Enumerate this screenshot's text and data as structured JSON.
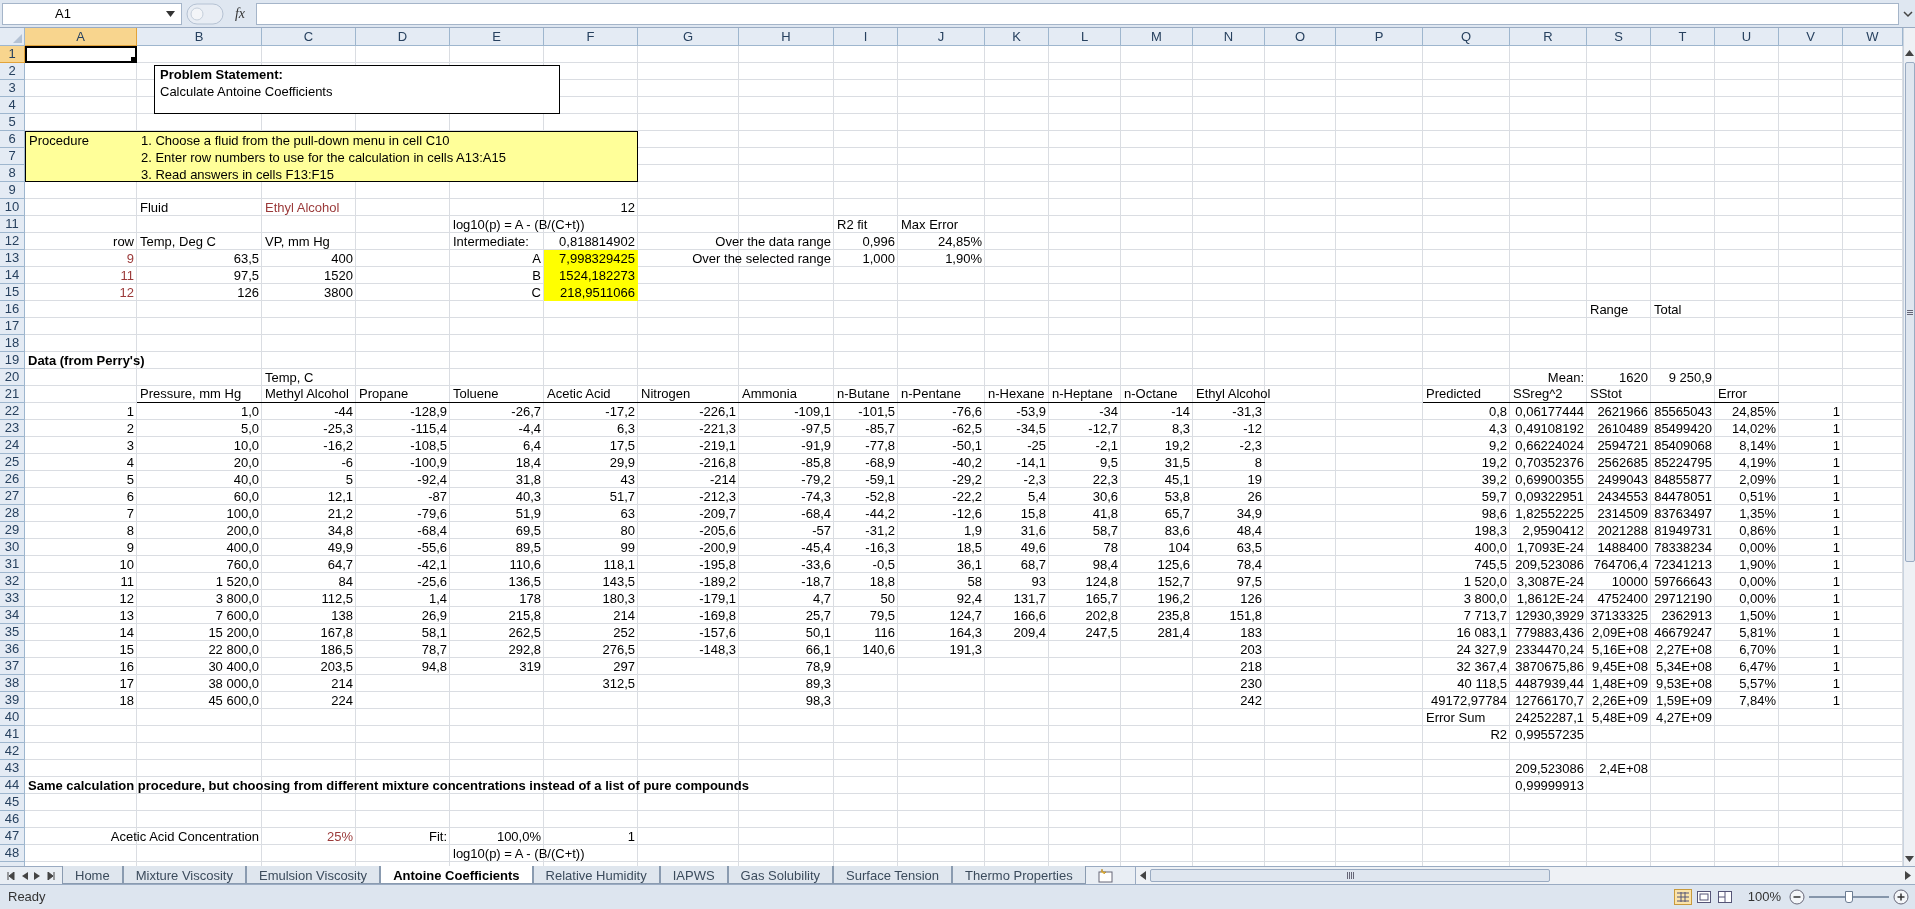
{
  "name_box": "A1",
  "insert_function": "fx",
  "columns": [
    {
      "label": "A",
      "selected": true
    },
    {
      "label": "B",
      "selected": false
    },
    {
      "label": "C",
      "selected": false
    },
    {
      "label": "D",
      "selected": false
    },
    {
      "label": "E",
      "selected": false
    },
    {
      "label": "F",
      "selected": false
    },
    {
      "label": "G",
      "selected": false
    },
    {
      "label": "H",
      "selected": false
    },
    {
      "label": "I",
      "selected": false
    },
    {
      "label": "J",
      "selected": false
    },
    {
      "label": "K",
      "selected": false
    },
    {
      "label": "L",
      "selected": false
    },
    {
      "label": "M",
      "selected": false
    },
    {
      "label": "N",
      "selected": false
    },
    {
      "label": "O",
      "selected": false
    },
    {
      "label": "P",
      "selected": false
    },
    {
      "label": "Q",
      "selected": false
    },
    {
      "label": "R",
      "selected": false
    },
    {
      "label": "S",
      "selected": false
    },
    {
      "label": "T",
      "selected": false
    },
    {
      "label": "U",
      "selected": false
    },
    {
      "label": "V",
      "selected": false
    },
    {
      "label": "W",
      "selected": false
    }
  ],
  "problem_statement": {
    "title": "Problem Statement:",
    "text": "Calculate Antoine Coefficients"
  },
  "procedure": {
    "label": "Procedure",
    "steps": [
      "1. Choose a fluid from the pull-down menu in cell C10",
      "2. Enter row numbers to use for the calculation in cells A13:A15",
      "3. Read answers in cells F13:F15"
    ]
  },
  "rows": [
    {
      "number": "1",
      "selected": true
    },
    {
      "number": "2",
      "selected": false
    },
    {
      "number": "3",
      "selected": false
    },
    {
      "number": "4",
      "selected": false
    },
    {
      "number": "5",
      "selected": false
    },
    {
      "number": "6",
      "selected": false
    },
    {
      "number": "7",
      "selected": false
    },
    {
      "number": "8",
      "selected": false
    },
    {
      "number": "9",
      "selected": false
    },
    {
      "number": "10",
      "selected": false,
      "cells": {
        "B": {
          "text": "Fluid",
          "kind": "text"
        },
        "C": {
          "text": "Ethyl Alcohol",
          "kind": "input-text"
        },
        "F": {
          "text": "12",
          "kind": "value"
        }
      }
    },
    {
      "number": "11",
      "selected": false,
      "cells": {
        "E": {
          "text": "log10(p) = A - (B/(C+t))",
          "kind": "text"
        },
        "I": {
          "text": "R2 fit",
          "kind": "text"
        },
        "J": {
          "text": "Max Error",
          "kind": "text"
        }
      }
    },
    {
      "number": "12",
      "selected": false,
      "cells": {
        "A": {
          "text": "row",
          "kind": "value"
        },
        "B": {
          "text": "Temp, Deg C",
          "kind": "text"
        },
        "C": {
          "text": "VP, mm Hg",
          "kind": "text"
        },
        "E": {
          "text": "Intermediate:",
          "kind": "text"
        },
        "F": {
          "text": "0,818814902",
          "kind": "value"
        },
        "H": {
          "text": "Over the data range",
          "kind": "value"
        },
        "I": {
          "text": "0,996",
          "kind": "value"
        },
        "J": {
          "text": "24,85%",
          "kind": "value"
        }
      }
    },
    {
      "number": "13",
      "selected": false,
      "cells": {
        "A": {
          "text": "9",
          "kind": "input-value"
        },
        "B": {
          "text": "63,5",
          "kind": "value"
        },
        "C": {
          "text": "400",
          "kind": "value"
        },
        "E": {
          "text": "A",
          "kind": "value"
        },
        "F": {
          "text": "7,998329425",
          "kind": "result"
        },
        "H": {
          "text": "Over the selected range",
          "kind": "value"
        },
        "I": {
          "text": "1,000",
          "kind": "value"
        },
        "J": {
          "text": "1,90%",
          "kind": "value"
        }
      }
    },
    {
      "number": "14",
      "selected": false,
      "cells": {
        "A": {
          "text": "11",
          "kind": "input-value"
        },
        "B": {
          "text": "97,5",
          "kind": "value"
        },
        "C": {
          "text": "1520",
          "kind": "value"
        },
        "E": {
          "text": "B",
          "kind": "value"
        },
        "F": {
          "text": "1524,182273",
          "kind": "result"
        }
      }
    },
    {
      "number": "15",
      "selected": false,
      "cells": {
        "A": {
          "text": "12",
          "kind": "input-value"
        },
        "B": {
          "text": "126",
          "kind": "value"
        },
        "C": {
          "text": "3800",
          "kind": "value"
        },
        "E": {
          "text": "C",
          "kind": "value"
        },
        "F": {
          "text": "218,9511066",
          "kind": "result"
        }
      }
    },
    {
      "number": "16",
      "selected": false,
      "cells": {
        "S": {
          "text": "Range",
          "kind": "text"
        },
        "T": {
          "text": "Total",
          "kind": "text"
        }
      }
    },
    {
      "number": "17",
      "selected": false
    },
    {
      "number": "18",
      "selected": false
    },
    {
      "number": "19",
      "selected": false,
      "cells": {
        "A": {
          "text": "Data (from Perry's)",
          "kind": "heading"
        }
      }
    },
    {
      "number": "20",
      "selected": false,
      "cells": {
        "C": {
          "text": "Temp, C",
          "kind": "text"
        },
        "R": {
          "text": "Mean:",
          "kind": "value"
        },
        "S": {
          "text": "1620",
          "kind": "value"
        },
        "T": {
          "text": "9 250,9",
          "kind": "value"
        }
      }
    },
    {
      "number": "21",
      "selected": false,
      "cells": {
        "B": {
          "text": "Pressure, mm Hg",
          "kind": "text",
          "underlined": true
        },
        "C": {
          "text": "Methyl Alcohol",
          "kind": "text",
          "underlined": true
        },
        "D": {
          "text": "Propane",
          "kind": "text",
          "underlined": true
        },
        "E": {
          "text": "Toluene",
          "kind": "text",
          "underlined": true
        },
        "F": {
          "text": "Acetic Acid",
          "kind": "text",
          "underlined": true
        },
        "G": {
          "text": "Nitrogen",
          "kind": "text",
          "underlined": true
        },
        "H": {
          "text": "Ammonia",
          "kind": "text",
          "underlined": true
        },
        "I": {
          "text": "n-Butane",
          "kind": "text",
          "underlined": true
        },
        "J": {
          "text": "n-Pentane",
          "kind": "text",
          "underlined": true
        },
        "K": {
          "text": "n-Hexane",
          "kind": "text",
          "underlined": true
        },
        "L": {
          "text": "n-Heptane",
          "kind": "text",
          "underlined": true
        },
        "M": {
          "text": "n-Octane",
          "kind": "text",
          "underlined": true
        },
        "N": {
          "text": "Ethyl Alcohol",
          "kind": "text",
          "underlined": true
        },
        "Q": {
          "text": "Predicted",
          "kind": "text",
          "underlined": true
        },
        "R": {
          "text": "SSreg^2",
          "kind": "text",
          "underlined": true
        },
        "S": {
          "text": "SStot",
          "kind": "text",
          "underlined": true
        },
        "T": {
          "underlined": true
        },
        "U": {
          "text": "Error",
          "kind": "text",
          "underlined": true
        }
      }
    },
    {
      "number": "22",
      "selected": false,
      "cells": {
        "A": {
          "text": "1",
          "kind": "value"
        },
        "B": {
          "text": "1,0",
          "kind": "value"
        },
        "C": {
          "text": "-44",
          "kind": "value"
        },
        "D": {
          "text": "-128,9",
          "kind": "value"
        },
        "E": {
          "text": "-26,7",
          "kind": "value"
        },
        "F": {
          "text": "-17,2",
          "kind": "value"
        },
        "G": {
          "text": "-226,1",
          "kind": "value"
        },
        "H": {
          "text": "-109,1",
          "kind": "value"
        },
        "I": {
          "text": "-101,5",
          "kind": "value"
        },
        "J": {
          "text": "-76,6",
          "kind": "value"
        },
        "K": {
          "text": "-53,9",
          "kind": "value"
        },
        "L": {
          "text": "-34",
          "kind": "value"
        },
        "M": {
          "text": "-14",
          "kind": "value"
        },
        "N": {
          "text": "-31,3",
          "kind": "value"
        },
        "Q": {
          "text": "0,8",
          "kind": "value"
        },
        "R": {
          "text": "0,06177444",
          "kind": "value"
        },
        "S": {
          "text": "2621966",
          "kind": "value"
        },
        "T": {
          "text": "85565043",
          "kind": "value"
        },
        "U": {
          "text": "24,85%",
          "kind": "value"
        },
        "V": {
          "text": "1",
          "kind": "value"
        }
      }
    },
    {
      "number": "23",
      "selected": false,
      "cells": {
        "A": {
          "text": "2",
          "kind": "value"
        },
        "B": {
          "text": "5,0",
          "kind": "value"
        },
        "C": {
          "text": "-25,3",
          "kind": "value"
        },
        "D": {
          "text": "-115,4",
          "kind": "value"
        },
        "E": {
          "text": "-4,4",
          "kind": "value"
        },
        "F": {
          "text": "6,3",
          "kind": "value"
        },
        "G": {
          "text": "-221,3",
          "kind": "value"
        },
        "H": {
          "text": "-97,5",
          "kind": "value"
        },
        "I": {
          "text": "-85,7",
          "kind": "value"
        },
        "J": {
          "text": "-62,5",
          "kind": "value"
        },
        "K": {
          "text": "-34,5",
          "kind": "value"
        },
        "L": {
          "text": "-12,7",
          "kind": "value"
        },
        "M": {
          "text": "8,3",
          "kind": "value"
        },
        "N": {
          "text": "-12",
          "kind": "value"
        },
        "Q": {
          "text": "4,3",
          "kind": "value"
        },
        "R": {
          "text": "0,49108192",
          "kind": "value"
        },
        "S": {
          "text": "2610489",
          "kind": "value"
        },
        "T": {
          "text": "85499420",
          "kind": "value"
        },
        "U": {
          "text": "14,02%",
          "kind": "value"
        },
        "V": {
          "text": "1",
          "kind": "value"
        }
      }
    },
    {
      "number": "24",
      "selected": false,
      "cells": {
        "A": {
          "text": "3",
          "kind": "value"
        },
        "B": {
          "text": "10,0",
          "kind": "value"
        },
        "C": {
          "text": "-16,2",
          "kind": "value"
        },
        "D": {
          "text": "-108,5",
          "kind": "value"
        },
        "E": {
          "text": "6,4",
          "kind": "value"
        },
        "F": {
          "text": "17,5",
          "kind": "value"
        },
        "G": {
          "text": "-219,1",
          "kind": "value"
        },
        "H": {
          "text": "-91,9",
          "kind": "value"
        },
        "I": {
          "text": "-77,8",
          "kind": "value"
        },
        "J": {
          "text": "-50,1",
          "kind": "value"
        },
        "K": {
          "text": "-25",
          "kind": "value"
        },
        "L": {
          "text": "-2,1",
          "kind": "value"
        },
        "M": {
          "text": "19,2",
          "kind": "value"
        },
        "N": {
          "text": "-2,3",
          "kind": "value"
        },
        "Q": {
          "text": "9,2",
          "kind": "value"
        },
        "R": {
          "text": "0,66224024",
          "kind": "value"
        },
        "S": {
          "text": "2594721",
          "kind": "value"
        },
        "T": {
          "text": "85409068",
          "kind": "value"
        },
        "U": {
          "text": "8,14%",
          "kind": "value"
        },
        "V": {
          "text": "1",
          "kind": "value"
        }
      }
    },
    {
      "number": "25",
      "selected": false,
      "cells": {
        "A": {
          "text": "4",
          "kind": "value"
        },
        "B": {
          "text": "20,0",
          "kind": "value"
        },
        "C": {
          "text": "-6",
          "kind": "value"
        },
        "D": {
          "text": "-100,9",
          "kind": "value"
        },
        "E": {
          "text": "18,4",
          "kind": "value"
        },
        "F": {
          "text": "29,9",
          "kind": "value"
        },
        "G": {
          "text": "-216,8",
          "kind": "value"
        },
        "H": {
          "text": "-85,8",
          "kind": "value"
        },
        "I": {
          "text": "-68,9",
          "kind": "value"
        },
        "J": {
          "text": "-40,2",
          "kind": "value"
        },
        "K": {
          "text": "-14,1",
          "kind": "value"
        },
        "L": {
          "text": "9,5",
          "kind": "value"
        },
        "M": {
          "text": "31,5",
          "kind": "value"
        },
        "N": {
          "text": "8",
          "kind": "value"
        },
        "Q": {
          "text": "19,2",
          "kind": "value"
        },
        "R": {
          "text": "0,70352376",
          "kind": "value"
        },
        "S": {
          "text": "2562685",
          "kind": "value"
        },
        "T": {
          "text": "85224795",
          "kind": "value"
        },
        "U": {
          "text": "4,19%",
          "kind": "value"
        },
        "V": {
          "text": "1",
          "kind": "value"
        }
      }
    },
    {
      "number": "26",
      "selected": false,
      "cells": {
        "A": {
          "text": "5",
          "kind": "value"
        },
        "B": {
          "text": "40,0",
          "kind": "value"
        },
        "C": {
          "text": "5",
          "kind": "value"
        },
        "D": {
          "text": "-92,4",
          "kind": "value"
        },
        "E": {
          "text": "31,8",
          "kind": "value"
        },
        "F": {
          "text": "43",
          "kind": "value"
        },
        "G": {
          "text": "-214",
          "kind": "value"
        },
        "H": {
          "text": "-79,2",
          "kind": "value"
        },
        "I": {
          "text": "-59,1",
          "kind": "value"
        },
        "J": {
          "text": "-29,2",
          "kind": "value"
        },
        "K": {
          "text": "-2,3",
          "kind": "value"
        },
        "L": {
          "text": "22,3",
          "kind": "value"
        },
        "M": {
          "text": "45,1",
          "kind": "value"
        },
        "N": {
          "text": "19",
          "kind": "value"
        },
        "Q": {
          "text": "39,2",
          "kind": "value"
        },
        "R": {
          "text": "0,69900355",
          "kind": "value"
        },
        "S": {
          "text": "2499043",
          "kind": "value"
        },
        "T": {
          "text": "84855877",
          "kind": "value"
        },
        "U": {
          "text": "2,09%",
          "kind": "value"
        },
        "V": {
          "text": "1",
          "kind": "value"
        }
      }
    },
    {
      "number": "27",
      "selected": false,
      "cells": {
        "A": {
          "text": "6",
          "kind": "value"
        },
        "B": {
          "text": "60,0",
          "kind": "value"
        },
        "C": {
          "text": "12,1",
          "kind": "value"
        },
        "D": {
          "text": "-87",
          "kind": "value"
        },
        "E": {
          "text": "40,3",
          "kind": "value"
        },
        "F": {
          "text": "51,7",
          "kind": "value"
        },
        "G": {
          "text": "-212,3",
          "kind": "value"
        },
        "H": {
          "text": "-74,3",
          "kind": "value"
        },
        "I": {
          "text": "-52,8",
          "kind": "value"
        },
        "J": {
          "text": "-22,2",
          "kind": "value"
        },
        "K": {
          "text": "5,4",
          "kind": "value"
        },
        "L": {
          "text": "30,6",
          "kind": "value"
        },
        "M": {
          "text": "53,8",
          "kind": "value"
        },
        "N": {
          "text": "26",
          "kind": "value"
        },
        "Q": {
          "text": "59,7",
          "kind": "value"
        },
        "R": {
          "text": "0,09322951",
          "kind": "value"
        },
        "S": {
          "text": "2434553",
          "kind": "value"
        },
        "T": {
          "text": "84478051",
          "kind": "value"
        },
        "U": {
          "text": "0,51%",
          "kind": "value"
        },
        "V": {
          "text": "1",
          "kind": "value"
        }
      }
    },
    {
      "number": "28",
      "selected": false,
      "cells": {
        "A": {
          "text": "7",
          "kind": "value"
        },
        "B": {
          "text": "100,0",
          "kind": "value"
        },
        "C": {
          "text": "21,2",
          "kind": "value"
        },
        "D": {
          "text": "-79,6",
          "kind": "value"
        },
        "E": {
          "text": "51,9",
          "kind": "value"
        },
        "F": {
          "text": "63",
          "kind": "value"
        },
        "G": {
          "text": "-209,7",
          "kind": "value"
        },
        "H": {
          "text": "-68,4",
          "kind": "value"
        },
        "I": {
          "text": "-44,2",
          "kind": "value"
        },
        "J": {
          "text": "-12,6",
          "kind": "value"
        },
        "K": {
          "text": "15,8",
          "kind": "value"
        },
        "L": {
          "text": "41,8",
          "kind": "value"
        },
        "M": {
          "text": "65,7",
          "kind": "value"
        },
        "N": {
          "text": "34,9",
          "kind": "value"
        },
        "Q": {
          "text": "98,6",
          "kind": "value"
        },
        "R": {
          "text": "1,82552225",
          "kind": "value"
        },
        "S": {
          "text": "2314509",
          "kind": "value"
        },
        "T": {
          "text": "83763497",
          "kind": "value"
        },
        "U": {
          "text": "1,35%",
          "kind": "value"
        },
        "V": {
          "text": "1",
          "kind": "value"
        }
      }
    },
    {
      "number": "29",
      "selected": false,
      "cells": {
        "A": {
          "text": "8",
          "kind": "value"
        },
        "B": {
          "text": "200,0",
          "kind": "value"
        },
        "C": {
          "text": "34,8",
          "kind": "value"
        },
        "D": {
          "text": "-68,4",
          "kind": "value"
        },
        "E": {
          "text": "69,5",
          "kind": "value"
        },
        "F": {
          "text": "80",
          "kind": "value"
        },
        "G": {
          "text": "-205,6",
          "kind": "value"
        },
        "H": {
          "text": "-57",
          "kind": "value"
        },
        "I": {
          "text": "-31,2",
          "kind": "value"
        },
        "J": {
          "text": "1,9",
          "kind": "value"
        },
        "K": {
          "text": "31,6",
          "kind": "value"
        },
        "L": {
          "text": "58,7",
          "kind": "value"
        },
        "M": {
          "text": "83,6",
          "kind": "value"
        },
        "N": {
          "text": "48,4",
          "kind": "value"
        },
        "Q": {
          "text": "198,3",
          "kind": "value"
        },
        "R": {
          "text": "2,9590412",
          "kind": "value"
        },
        "S": {
          "text": "2021288",
          "kind": "value"
        },
        "T": {
          "text": "81949731",
          "kind": "value"
        },
        "U": {
          "text": "0,86%",
          "kind": "value"
        },
        "V": {
          "text": "1",
          "kind": "value"
        }
      }
    },
    {
      "number": "30",
      "selected": false,
      "cells": {
        "A": {
          "text": "9",
          "kind": "value"
        },
        "B": {
          "text": "400,0",
          "kind": "value"
        },
        "C": {
          "text": "49,9",
          "kind": "value"
        },
        "D": {
          "text": "-55,6",
          "kind": "value"
        },
        "E": {
          "text": "89,5",
          "kind": "value"
        },
        "F": {
          "text": "99",
          "kind": "value"
        },
        "G": {
          "text": "-200,9",
          "kind": "value"
        },
        "H": {
          "text": "-45,4",
          "kind": "value"
        },
        "I": {
          "text": "-16,3",
          "kind": "value"
        },
        "J": {
          "text": "18,5",
          "kind": "value"
        },
        "K": {
          "text": "49,6",
          "kind": "value"
        },
        "L": {
          "text": "78",
          "kind": "value"
        },
        "M": {
          "text": "104",
          "kind": "value"
        },
        "N": {
          "text": "63,5",
          "kind": "value"
        },
        "Q": {
          "text": "400,0",
          "kind": "value"
        },
        "R": {
          "text": "1,7093E-24",
          "kind": "value"
        },
        "S": {
          "text": "1488400",
          "kind": "value"
        },
        "T": {
          "text": "78338234",
          "kind": "value"
        },
        "U": {
          "text": "0,00%",
          "kind": "value"
        },
        "V": {
          "text": "1",
          "kind": "value"
        }
      }
    },
    {
      "number": "31",
      "selected": false,
      "cells": {
        "A": {
          "text": "10",
          "kind": "value"
        },
        "B": {
          "text": "760,0",
          "kind": "value"
        },
        "C": {
          "text": "64,7",
          "kind": "value"
        },
        "D": {
          "text": "-42,1",
          "kind": "value"
        },
        "E": {
          "text": "110,6",
          "kind": "value"
        },
        "F": {
          "text": "118,1",
          "kind": "value"
        },
        "G": {
          "text": "-195,8",
          "kind": "value"
        },
        "H": {
          "text": "-33,6",
          "kind": "value"
        },
        "I": {
          "text": "-0,5",
          "kind": "value"
        },
        "J": {
          "text": "36,1",
          "kind": "value"
        },
        "K": {
          "text": "68,7",
          "kind": "value"
        },
        "L": {
          "text": "98,4",
          "kind": "value"
        },
        "M": {
          "text": "125,6",
          "kind": "value"
        },
        "N": {
          "text": "78,4",
          "kind": "value"
        },
        "Q": {
          "text": "745,5",
          "kind": "value"
        },
        "R": {
          "text": "209,523086",
          "kind": "value"
        },
        "S": {
          "text": "764706,4",
          "kind": "value"
        },
        "T": {
          "text": "72341213",
          "kind": "value"
        },
        "U": {
          "text": "1,90%",
          "kind": "value"
        },
        "V": {
          "text": "1",
          "kind": "value"
        }
      }
    },
    {
      "number": "32",
      "selected": false,
      "cells": {
        "A": {
          "text": "11",
          "kind": "value"
        },
        "B": {
          "text": "1 520,0",
          "kind": "value"
        },
        "C": {
          "text": "84",
          "kind": "value"
        },
        "D": {
          "text": "-25,6",
          "kind": "value"
        },
        "E": {
          "text": "136,5",
          "kind": "value"
        },
        "F": {
          "text": "143,5",
          "kind": "value"
        },
        "G": {
          "text": "-189,2",
          "kind": "value"
        },
        "H": {
          "text": "-18,7",
          "kind": "value"
        },
        "I": {
          "text": "18,8",
          "kind": "value"
        },
        "J": {
          "text": "58",
          "kind": "value"
        },
        "K": {
          "text": "93",
          "kind": "value"
        },
        "L": {
          "text": "124,8",
          "kind": "value"
        },
        "M": {
          "text": "152,7",
          "kind": "value"
        },
        "N": {
          "text": "97,5",
          "kind": "value"
        },
        "Q": {
          "text": "1 520,0",
          "kind": "value"
        },
        "R": {
          "text": "3,3087E-24",
          "kind": "value"
        },
        "S": {
          "text": "10000",
          "kind": "value"
        },
        "T": {
          "text": "59766643",
          "kind": "value"
        },
        "U": {
          "text": "0,00%",
          "kind": "value"
        },
        "V": {
          "text": "1",
          "kind": "value"
        }
      }
    },
    {
      "number": "33",
      "selected": false,
      "cells": {
        "A": {
          "text": "12",
          "kind": "value"
        },
        "B": {
          "text": "3 800,0",
          "kind": "value"
        },
        "C": {
          "text": "112,5",
          "kind": "value"
        },
        "D": {
          "text": "1,4",
          "kind": "value"
        },
        "E": {
          "text": "178",
          "kind": "value"
        },
        "F": {
          "text": "180,3",
          "kind": "value"
        },
        "G": {
          "text": "-179,1",
          "kind": "value"
        },
        "H": {
          "text": "4,7",
          "kind": "value"
        },
        "I": {
          "text": "50",
          "kind": "value"
        },
        "J": {
          "text": "92,4",
          "kind": "value"
        },
        "K": {
          "text": "131,7",
          "kind": "value"
        },
        "L": {
          "text": "165,7",
          "kind": "value"
        },
        "M": {
          "text": "196,2",
          "kind": "value"
        },
        "N": {
          "text": "126",
          "kind": "value"
        },
        "Q": {
          "text": "3 800,0",
          "kind": "value"
        },
        "R": {
          "text": "1,8612E-24",
          "kind": "value"
        },
        "S": {
          "text": "4752400",
          "kind": "value"
        },
        "T": {
          "text": "29712190",
          "kind": "value"
        },
        "U": {
          "text": "0,00%",
          "kind": "value"
        },
        "V": {
          "text": "1",
          "kind": "value"
        }
      }
    },
    {
      "number": "34",
      "selected": false,
      "cells": {
        "A": {
          "text": "13",
          "kind": "value"
        },
        "B": {
          "text": "7 600,0",
          "kind": "value"
        },
        "C": {
          "text": "138",
          "kind": "value"
        },
        "D": {
          "text": "26,9",
          "kind": "value"
        },
        "E": {
          "text": "215,8",
          "kind": "value"
        },
        "F": {
          "text": "214",
          "kind": "value"
        },
        "G": {
          "text": "-169,8",
          "kind": "value"
        },
        "H": {
          "text": "25,7",
          "kind": "value"
        },
        "I": {
          "text": "79,5",
          "kind": "value"
        },
        "J": {
          "text": "124,7",
          "kind": "value"
        },
        "K": {
          "text": "166,6",
          "kind": "value"
        },
        "L": {
          "text": "202,8",
          "kind": "value"
        },
        "M": {
          "text": "235,8",
          "kind": "value"
        },
        "N": {
          "text": "151,8",
          "kind": "value"
        },
        "Q": {
          "text": "7 713,7",
          "kind": "value"
        },
        "R": {
          "text": "12930,3929",
          "kind": "value"
        },
        "S": {
          "text": "37133325",
          "kind": "value"
        },
        "T": {
          "text": "2362913",
          "kind": "value"
        },
        "U": {
          "text": "1,50%",
          "kind": "value"
        },
        "V": {
          "text": "1",
          "kind": "value"
        }
      }
    },
    {
      "number": "35",
      "selected": false,
      "cells": {
        "A": {
          "text": "14",
          "kind": "value"
        },
        "B": {
          "text": "15 200,0",
          "kind": "value"
        },
        "C": {
          "text": "167,8",
          "kind": "value"
        },
        "D": {
          "text": "58,1",
          "kind": "value"
        },
        "E": {
          "text": "262,5",
          "kind": "value"
        },
        "F": {
          "text": "252",
          "kind": "value"
        },
        "G": {
          "text": "-157,6",
          "kind": "value"
        },
        "H": {
          "text": "50,1",
          "kind": "value"
        },
        "I": {
          "text": "116",
          "kind": "value"
        },
        "J": {
          "text": "164,3",
          "kind": "value"
        },
        "K": {
          "text": "209,4",
          "kind": "value"
        },
        "L": {
          "text": "247,5",
          "kind": "value"
        },
        "M": {
          "text": "281,4",
          "kind": "value"
        },
        "N": {
          "text": "183",
          "kind": "value"
        },
        "Q": {
          "text": "16 083,1",
          "kind": "value"
        },
        "R": {
          "text": "779883,436",
          "kind": "value"
        },
        "S": {
          "text": "2,09E+08",
          "kind": "value"
        },
        "T": {
          "text": "46679247",
          "kind": "value"
        },
        "U": {
          "text": "5,81%",
          "kind": "value"
        },
        "V": {
          "text": "1",
          "kind": "value"
        }
      }
    },
    {
      "number": "36",
      "selected": false,
      "cells": {
        "A": {
          "text": "15",
          "kind": "value"
        },
        "B": {
          "text": "22 800,0",
          "kind": "value"
        },
        "C": {
          "text": "186,5",
          "kind": "value"
        },
        "D": {
          "text": "78,7",
          "kind": "value"
        },
        "E": {
          "text": "292,8",
          "kind": "value"
        },
        "F": {
          "text": "276,5",
          "kind": "value"
        },
        "G": {
          "text": "-148,3",
          "kind": "value"
        },
        "H": {
          "text": "66,1",
          "kind": "value"
        },
        "I": {
          "text": "140,6",
          "kind": "value"
        },
        "J": {
          "text": "191,3",
          "kind": "value"
        },
        "N": {
          "text": "203",
          "kind": "value"
        },
        "Q": {
          "text": "24 327,9",
          "kind": "value"
        },
        "R": {
          "text": "2334470,24",
          "kind": "value"
        },
        "S": {
          "text": "5,16E+08",
          "kind": "value"
        },
        "T": {
          "text": "2,27E+08",
          "kind": "value"
        },
        "U": {
          "text": "6,70%",
          "kind": "value"
        },
        "V": {
          "text": "1",
          "kind": "value"
        }
      }
    },
    {
      "number": "37",
      "selected": false,
      "cells": {
        "A": {
          "text": "16",
          "kind": "value"
        },
        "B": {
          "text": "30 400,0",
          "kind": "value"
        },
        "C": {
          "text": "203,5",
          "kind": "value"
        },
        "D": {
          "text": "94,8",
          "kind": "value"
        },
        "E": {
          "text": "319",
          "kind": "value"
        },
        "F": {
          "text": "297",
          "kind": "value"
        },
        "H": {
          "text": "78,9",
          "kind": "value"
        },
        "N": {
          "text": "218",
          "kind": "value"
        },
        "Q": {
          "text": "32 367,4",
          "kind": "value"
        },
        "R": {
          "text": "3870675,86",
          "kind": "value"
        },
        "S": {
          "text": "9,45E+08",
          "kind": "value"
        },
        "T": {
          "text": "5,34E+08",
          "kind": "value"
        },
        "U": {
          "text": "6,47%",
          "kind": "value"
        },
        "V": {
          "text": "1",
          "kind": "value"
        }
      }
    },
    {
      "number": "38",
      "selected": false,
      "cells": {
        "A": {
          "text": "17",
          "kind": "value"
        },
        "B": {
          "text": "38 000,0",
          "kind": "value"
        },
        "C": {
          "text": "214",
          "kind": "value"
        },
        "F": {
          "text": "312,5",
          "kind": "value"
        },
        "H": {
          "text": "89,3",
          "kind": "value"
        },
        "N": {
          "text": "230",
          "kind": "value"
        },
        "Q": {
          "text": "40 118,5",
          "kind": "value"
        },
        "R": {
          "text": "4487939,44",
          "kind": "value"
        },
        "S": {
          "text": "1,48E+09",
          "kind": "value"
        },
        "T": {
          "text": "9,53E+08",
          "kind": "value"
        },
        "U": {
          "text": "5,57%",
          "kind": "value"
        },
        "V": {
          "text": "1",
          "kind": "value"
        }
      }
    },
    {
      "number": "39",
      "selected": false,
      "cells": {
        "A": {
          "text": "18",
          "kind": "value"
        },
        "B": {
          "text": "45 600,0",
          "kind": "value"
        },
        "C": {
          "text": "224",
          "kind": "value"
        },
        "H": {
          "text": "98,3",
          "kind": "value"
        },
        "N": {
          "text": "242",
          "kind": "value"
        },
        "Q": {
          "text": "49172,97784",
          "kind": "value"
        },
        "R": {
          "text": "12766170,7",
          "kind": "value"
        },
        "S": {
          "text": "2,26E+09",
          "kind": "value"
        },
        "T": {
          "text": "1,59E+09",
          "kind": "value"
        },
        "U": {
          "text": "7,84%",
          "kind": "value"
        },
        "V": {
          "text": "1",
          "kind": "value"
        }
      }
    },
    {
      "number": "40",
      "selected": false,
      "cells": {
        "Q": {
          "text": "Error Sum",
          "kind": "text"
        },
        "R": {
          "text": "24252287,1",
          "kind": "value"
        },
        "S": {
          "text": "5,48E+09",
          "kind": "value"
        },
        "T": {
          "text": "4,27E+09",
          "kind": "value"
        }
      }
    },
    {
      "number": "41",
      "selected": false,
      "cells": {
        "Q": {
          "text": "R2",
          "kind": "value"
        },
        "R": {
          "text": "0,99557235",
          "kind": "value"
        }
      }
    },
    {
      "number": "42",
      "selected": false
    },
    {
      "number": "43",
      "selected": false,
      "cells": {
        "R": {
          "text": "209,523086",
          "kind": "value"
        },
        "S": {
          "text": "2,4E+08",
          "kind": "value"
        }
      }
    },
    {
      "number": "44",
      "selected": false,
      "cells": {
        "A": {
          "text": "Same calculation procedure, but choosing from different mixture concentrations instead of a list of pure compounds",
          "kind": "heading"
        },
        "R": {
          "text": "0,99999913",
          "kind": "value"
        }
      }
    },
    {
      "number": "45",
      "selected": false
    },
    {
      "number": "46",
      "selected": false
    },
    {
      "number": "47",
      "selected": false,
      "cells": {
        "B": {
          "text": "Acetic Acid Concentration",
          "kind": "value"
        },
        "C": {
          "text": "25%",
          "kind": "input-value"
        },
        "D": {
          "text": "Fit:",
          "kind": "value"
        },
        "E": {
          "text": "100,0%",
          "kind": "value"
        },
        "F": {
          "text": "1",
          "kind": "value"
        }
      }
    },
    {
      "number": "48",
      "selected": false,
      "cells": {
        "E": {
          "text": "log10(p) = A - (B/(C+t))",
          "kind": "text"
        }
      }
    }
  ],
  "sheet_tabs": [
    {
      "label": "Home",
      "selected": false
    },
    {
      "label": "Mixture Viscosity",
      "selected": false
    },
    {
      "label": "Emulsion Viscosity",
      "selected": false
    },
    {
      "label": "Antoine Coefficients",
      "selected": true
    },
    {
      "label": "Relative Humidity",
      "selected": false
    },
    {
      "label": "IAPWS",
      "selected": false
    },
    {
      "label": "Gas Solubility",
      "selected": false
    },
    {
      "label": "Surface Tension",
      "selected": false
    },
    {
      "label": "Thermo Properties",
      "selected": false
    }
  ],
  "status_bar": {
    "text": "Ready",
    "zoom": "100%",
    "zoom_slider": {
      "level": 0.5
    }
  }
}
